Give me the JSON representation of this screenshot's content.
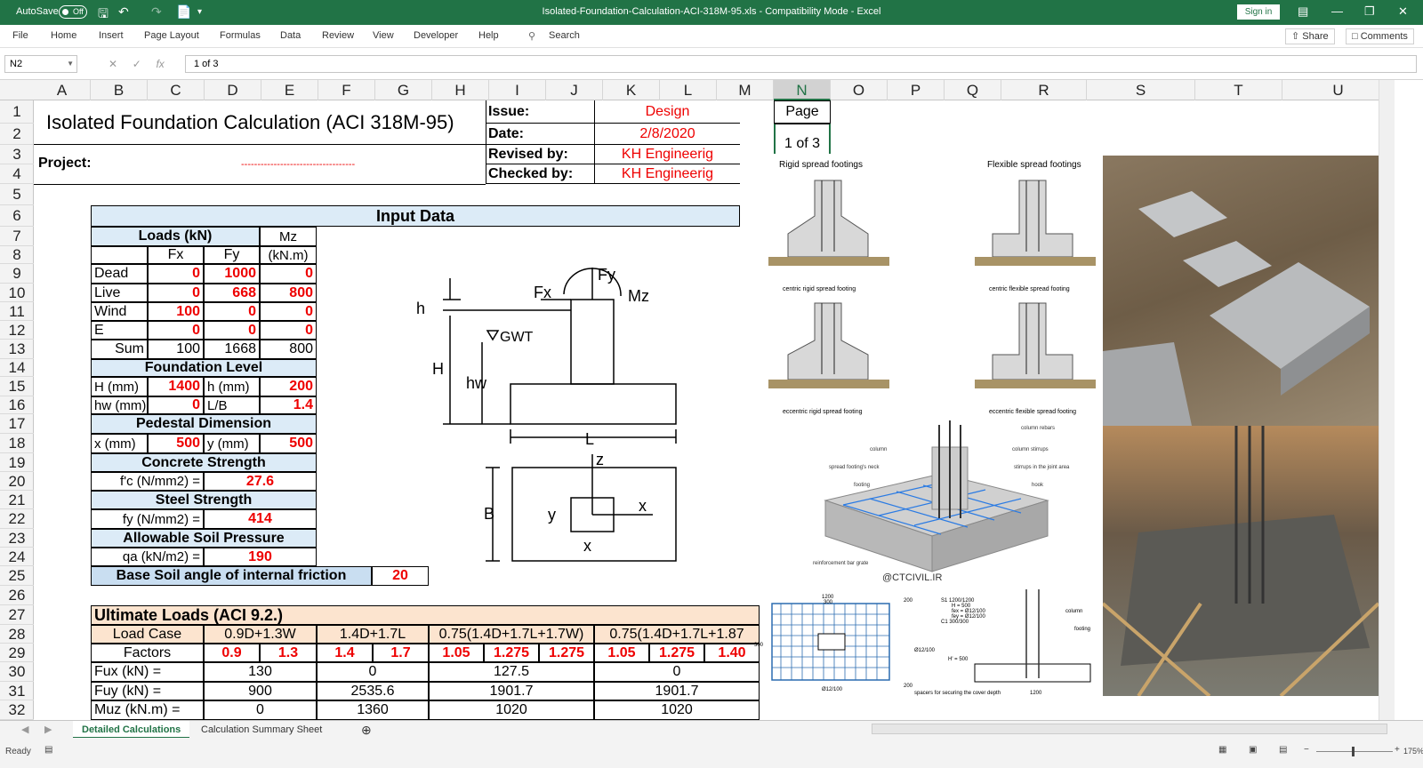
{
  "titlebar": {
    "autosave_label": "AutoSave",
    "autosave_state": "Off",
    "doc_title": "Isolated-Foundation-Calculation-ACI-318M-95.xls  -  Compatibility Mode  -  Excel",
    "signin": "Sign in"
  },
  "menu": [
    "File",
    "Home",
    "Insert",
    "Page Layout",
    "Formulas",
    "Data",
    "Review",
    "View",
    "Developer",
    "Help"
  ],
  "search": "Search",
  "share": "Share",
  "comments": "Comments",
  "formula_bar": {
    "name_box": "N2",
    "value": "1 of 3"
  },
  "columns": [
    "A",
    "B",
    "C",
    "D",
    "E",
    "F",
    "G",
    "H",
    "I",
    "J",
    "K",
    "L",
    "M",
    "N",
    "O",
    "P",
    "Q",
    "R",
    "S",
    "T",
    "U"
  ],
  "rows": [
    "1",
    "2",
    "3",
    "4",
    "5",
    "6",
    "7",
    "8",
    "9",
    "10",
    "11",
    "12",
    "13",
    "14",
    "15",
    "16",
    "17",
    "18",
    "19",
    "20",
    "21",
    "22",
    "23",
    "24",
    "25",
    "26",
    "27",
    "28",
    "29",
    "30",
    "31",
    "32"
  ],
  "header_block": {
    "title": "Isolated Foundation Calculation (ACI 318M-95)",
    "project_label": "Project:",
    "project_value": "-----------------------------------",
    "issue_label": "Issue:",
    "issue_value": "Design",
    "date_label": "Date:",
    "date_value": "2/8/2020",
    "revised_label": "Revised by:",
    "revised_value": "KH Engineerig",
    "checked_label": "Checked by:",
    "checked_value": "KH Engineerig",
    "page_label": "Page",
    "page_value": "1 of 3"
  },
  "input": {
    "title": "Input Data",
    "loads_title": "Loads (kN)",
    "mz_header": "Mz",
    "mz_unit": "(kN.m)",
    "fx_header": "Fx",
    "fy_header": "Fy",
    "load_rows": [
      {
        "label": "Dead",
        "fx": "0",
        "fy": "1000",
        "mz": "0"
      },
      {
        "label": "Live",
        "fx": "0",
        "fy": "668",
        "mz": "800"
      },
      {
        "label": "Wind",
        "fx": "100",
        "fy": "0",
        "mz": "0"
      },
      {
        "label": "E",
        "fx": "0",
        "fy": "0",
        "mz": "0"
      },
      {
        "label": "Sum",
        "fx": "100",
        "fy": "1668",
        "mz": "800"
      }
    ],
    "foundation_level": "Foundation Level",
    "H_label": "H (mm)",
    "H_value": "1400",
    "h_label": "h (mm)",
    "h_value": "200",
    "hw_label": "hw (mm)",
    "hw_value": "0",
    "LB_label": "L/B",
    "LB_value": "1.4",
    "pedestal": "Pedestal Dimension",
    "x_label": "x (mm)",
    "x_value": "500",
    "y_label": "y (mm)",
    "y_value": "500",
    "concrete": "Concrete Strength",
    "fc_label": "f'c (N/mm2) =",
    "fc_value": "27.6",
    "steel": "Steel Strength",
    "fy_label": "fy (N/mm2) =",
    "fy_value": "414",
    "soil": "Allowable Soil Pressure",
    "qa_label": "qa (kN/m2) =",
    "qa_value": "190",
    "friction_label": "Base Soil angle of internal friction",
    "friction_value": "20"
  },
  "ultimate": {
    "title": "Ultimate Loads (ACI 9.2.)",
    "load_case": "Load Case",
    "cases": [
      "0.9D+1.3W",
      "1.4D+1.7L",
      "0.75(1.4D+1.7L+1.7W)",
      "0.75(1.4D+1.7L+1.87"
    ],
    "factors_label": "Factors",
    "factors": [
      "0.9",
      "1.3",
      "1.4",
      "1.7",
      "1.05",
      "1.275",
      "1.275",
      "1.05",
      "1.275",
      "1.40"
    ],
    "fux_label": "Fux (kN) =",
    "fux": [
      "130",
      "0",
      "127.5",
      "0"
    ],
    "fuy_label": "Fuy (kN) =",
    "fuy": [
      "900",
      "2535.6",
      "1901.7",
      "1901.7"
    ],
    "muz_label": "Muz (kN.m) =",
    "muz": [
      "0",
      "1360",
      "1020",
      "1020"
    ]
  },
  "sketch": {
    "fy": "Fy",
    "fx": "Fx",
    "mz": "Mz",
    "h": "h",
    "H": "H",
    "gwt": "GWT",
    "hw": "hw",
    "L": "L",
    "z": "z",
    "B": "B",
    "y": "y",
    "x_axis": "x",
    "x_dim": "x"
  },
  "footings_image": {
    "rigid": "Rigid spread footings",
    "flexible": "Flexible spread footings",
    "centric_rigid": "centric rigid spread footing",
    "centric_flexible": "centric flexible spread footing",
    "eccentric_rigid": "eccentric rigid spread footing",
    "eccentric_flexible": "eccentric flexible spread footing"
  },
  "isometric_image": {
    "column_rebars": "column rebars",
    "column": "column",
    "column_stirrups": "column stirrups",
    "neck": "spread footing's neck",
    "stirrups_joint": "stirrups in the joint area",
    "footing": "footing",
    "hook": "hook",
    "grate": "reinforcement bar grate",
    "watermark": "@CTCIVIL.IR"
  },
  "detail_image": {
    "d1200": "1200",
    "d300": "300",
    "d200a": "200",
    "rebar_v": "Ø12/100",
    "d300v": "300",
    "d200b": "200",
    "rebar_h": "Ø12/100",
    "spec1": "S1 1200/1200",
    "spec2": "H = 500",
    "spec3": "fex = Ø12/100",
    "spec4": "fey = Ø12/100",
    "spec5": "C1 300/300",
    "col": "column",
    "ftg": "footing",
    "hprime": "H' = 500",
    "spacers": "spacers for securing the cover depth",
    "d1200b": "1200"
  },
  "sheet_tabs": [
    "Detailed Calculations",
    "Calculation Summary Sheet"
  ],
  "status": {
    "ready": "Ready",
    "zoom": "175%"
  }
}
